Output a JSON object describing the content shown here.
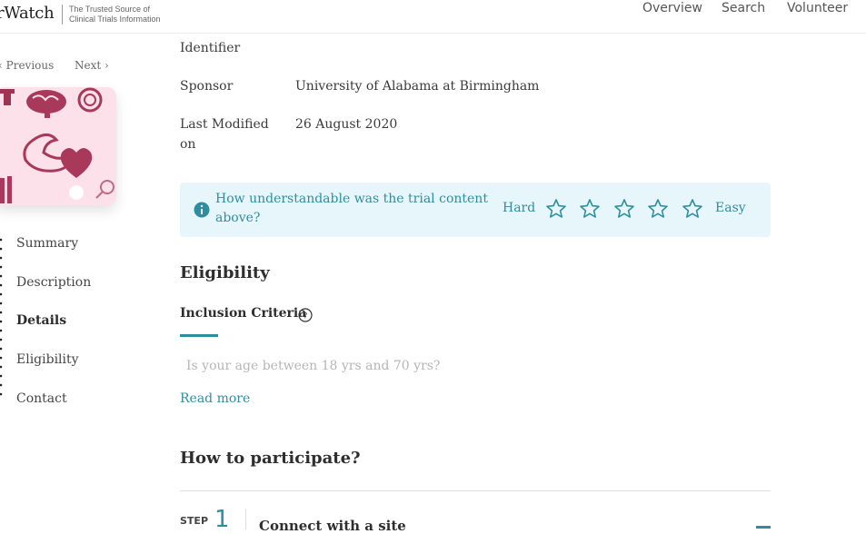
{
  "header": {
    "logo_text": "rWatch",
    "tagline": "The Trusted Source of Clinical Trials Information",
    "nav": [
      "Overview",
      "Search",
      "Volunteer"
    ]
  },
  "pager": {
    "previous": "Previous",
    "next": "Next"
  },
  "sidebar": {
    "items": [
      {
        "label": "Summary",
        "active": false
      },
      {
        "label": "Description",
        "active": false
      },
      {
        "label": "Details",
        "active": true
      },
      {
        "label": "Eligibility",
        "active": false
      },
      {
        "label": "Contact",
        "active": false
      }
    ]
  },
  "details": {
    "identifier_label": "Identifier",
    "sponsor_label": "Sponsor",
    "sponsor_value": "University of Alabama at Birmingham",
    "modified_label": "Last Modified on",
    "modified_value": "26 August 2020"
  },
  "rating": {
    "question": "How understandable was the trial content above?",
    "low": "Hard",
    "high": "Easy",
    "stars_total": 5,
    "stars_filled": 0,
    "accent": "#2e8ea0",
    "background": "#e7f6fa"
  },
  "eligibility": {
    "heading": "Eligibility",
    "criteria_title": "Inclusion Criteria",
    "first_question": "Is your age between 18 yrs and 70 yrs?",
    "read_more": "Read more"
  },
  "participate": {
    "heading": "How to participate?",
    "step_label": "STEP",
    "step_number": "1",
    "step_title": "Connect with a site"
  }
}
